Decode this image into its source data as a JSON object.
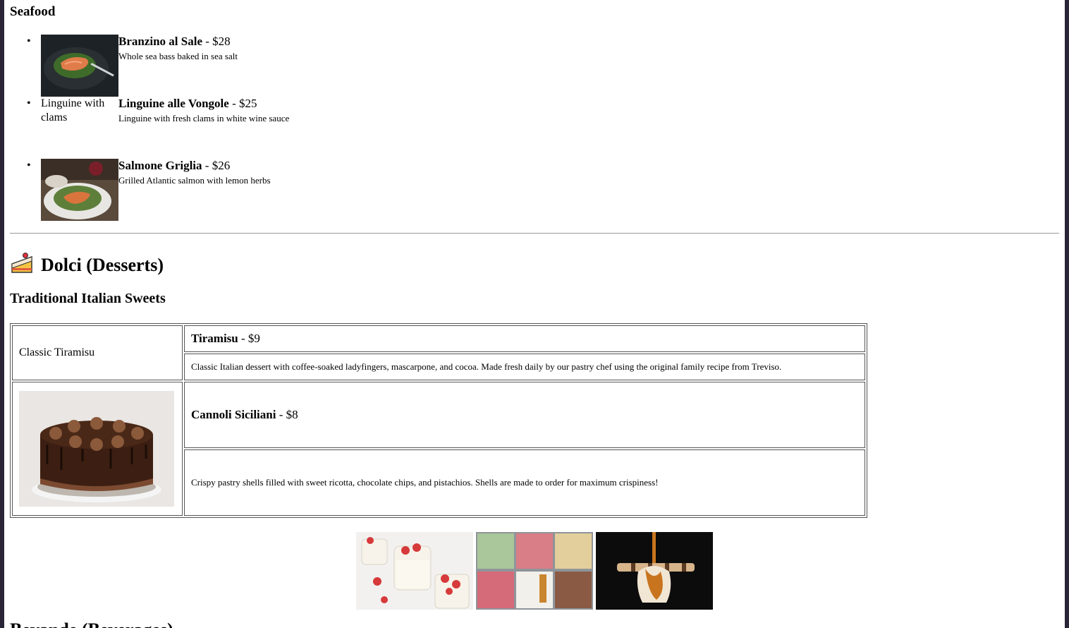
{
  "seafood": {
    "title": "Seafood",
    "items": [
      {
        "name": "Branzino al Sale",
        "price": " - $28",
        "desc": "Whole sea bass baked in sea salt",
        "image": "photo",
        "image_icon": "salmon-plate-photo"
      },
      {
        "name": "Linguine alle Vongole",
        "price": " - $25",
        "desc": "Linguine with fresh clams in white wine sauce",
        "image": "broken",
        "alt": "Linguine with clams"
      },
      {
        "name": "Salmone Griglia",
        "price": " - $26",
        "desc": "Grilled Atlantic salmon with lemon herbs",
        "image": "photo",
        "image_icon": "grilled-salmon-photo"
      }
    ]
  },
  "dolci": {
    "emoji": "🍰",
    "title": "Dolci (Desserts)",
    "subtitle": "Traditional Italian Sweets",
    "items": [
      {
        "name": "Tiramisu",
        "price": " - $9",
        "desc": "Classic Italian dessert with coffee-soaked ladyfingers, mascarpone, and cocoa. Made fresh daily by our pastry chef using the original family recipe from Treviso.",
        "image": "broken",
        "alt": "Classic Tiramisu"
      },
      {
        "name": "Cannoli Siciliani",
        "price": " - $8",
        "desc": "Crispy pastry shells filled with sweet ricotta, chocolate chips, and pistachios. Shells are made to order for maximum crispiness!",
        "image": "photo",
        "image_icon": "chocolate-cake-photo"
      }
    ]
  },
  "gallery": [
    {
      "icon": "panna-cotta-photo"
    },
    {
      "icon": "gelato-tubs-photo"
    },
    {
      "icon": "caramel-dessert-photo"
    }
  ],
  "cutoff_heading": "Bevande (Beverages)"
}
